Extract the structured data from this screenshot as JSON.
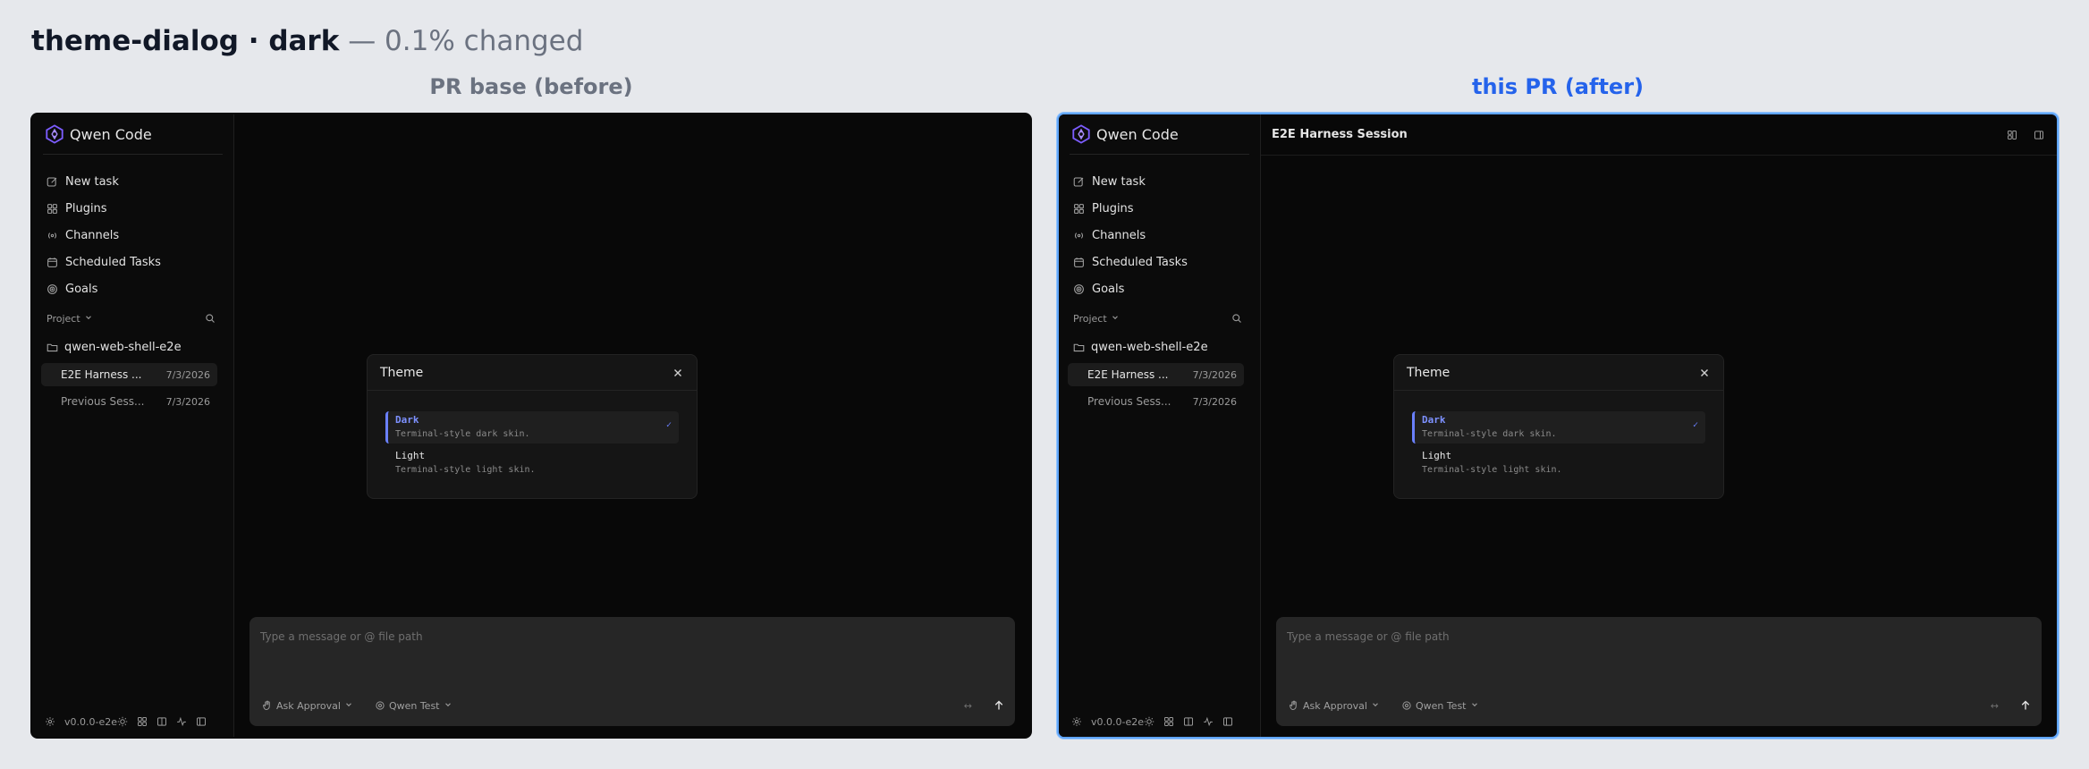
{
  "heading": {
    "bold": "theme-dialog · dark",
    "light": "— 0.1% changed"
  },
  "labels": {
    "before": "PR base (before)",
    "after": "this PR (after)"
  },
  "app": {
    "name": "Qwen Code",
    "nav": [
      "New task",
      "Plugins",
      "Channels",
      "Scheduled Tasks",
      "Goals"
    ],
    "project_label": "Project",
    "folder": "qwen-web-shell-e2e",
    "sessions": [
      {
        "title": "E2E Harness ...",
        "date": "7/3/2026"
      },
      {
        "title": "Previous Sess...",
        "date": "7/3/2026"
      }
    ],
    "version": "v0.0.0-e2e",
    "session_title": "E2E Harness Session",
    "theme_dialog": {
      "title": "Theme",
      "options": [
        {
          "name": "Dark",
          "desc": "Terminal-style dark skin.",
          "check": "✓"
        },
        {
          "name": "Light",
          "desc": "Terminal-style light skin."
        }
      ]
    },
    "composer": {
      "placeholder": "Type a message or @ file path",
      "approval": "Ask Approval",
      "model": "Qwen Test",
      "expand": "↔"
    }
  },
  "colors": {
    "accent": "#6a80ff",
    "after_border": "#60a5fa",
    "after_label": "#2563eb"
  }
}
